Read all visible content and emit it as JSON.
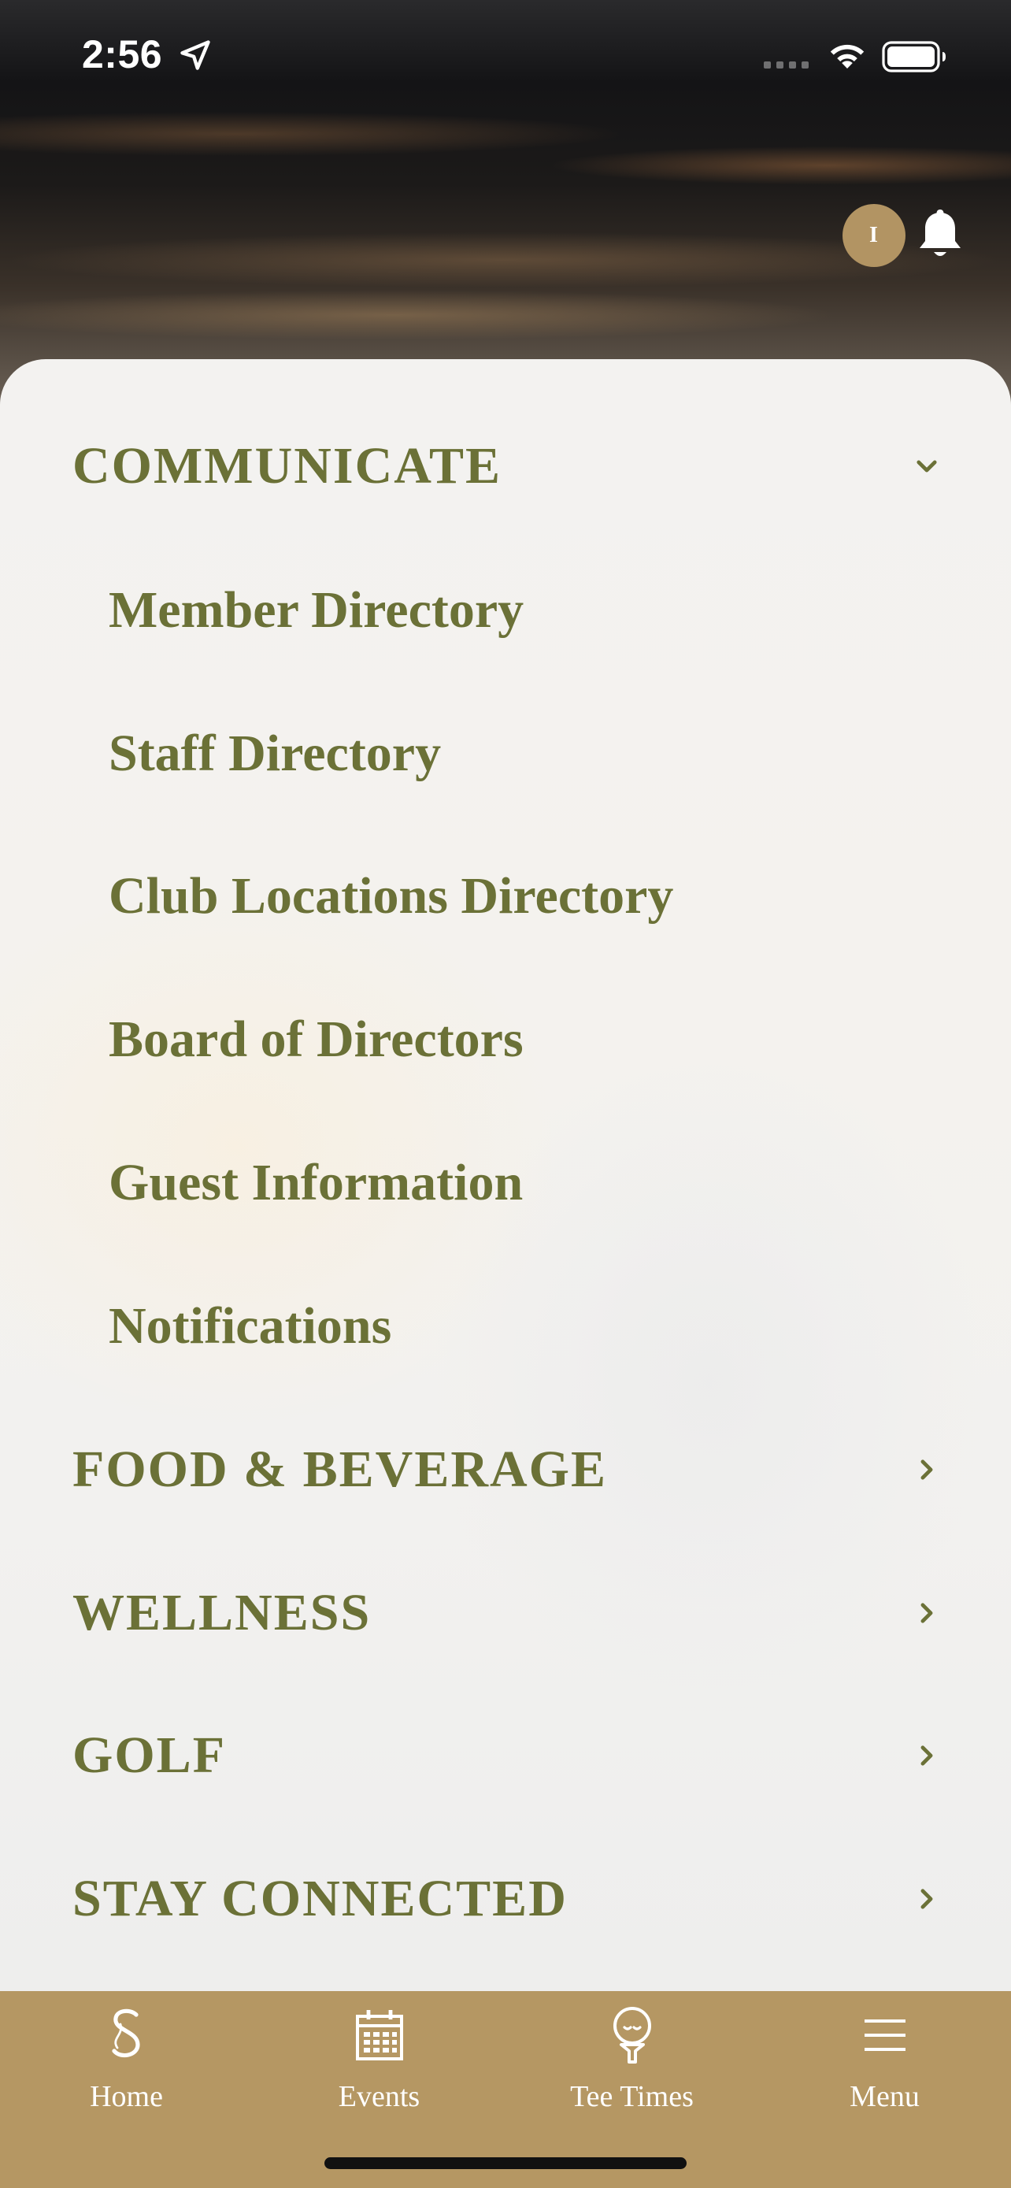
{
  "status_bar": {
    "time": "2:56"
  },
  "header": {
    "avatar_initial": "I"
  },
  "menu": {
    "sections": [
      {
        "label": "COMMUNICATE",
        "expanded": true,
        "items": [
          {
            "label": "Member Directory"
          },
          {
            "label": "Staff Directory"
          },
          {
            "label": "Club Locations Directory"
          },
          {
            "label": "Board of Directors"
          },
          {
            "label": "Guest Information"
          },
          {
            "label": "Notifications"
          }
        ]
      },
      {
        "label": "FOOD & BEVERAGE",
        "expanded": false
      },
      {
        "label": "WELLNESS",
        "expanded": false
      },
      {
        "label": "GOLF",
        "expanded": false
      },
      {
        "label": "STAY CONNECTED",
        "expanded": false
      }
    ]
  },
  "tab_bar": {
    "tabs": [
      {
        "label": "Home",
        "icon": "home-logo-icon"
      },
      {
        "label": "Events",
        "icon": "calendar-icon"
      },
      {
        "label": "Tee Times",
        "icon": "golf-ball-tee-icon"
      },
      {
        "label": "Menu",
        "icon": "hamburger-menu-icon"
      }
    ]
  },
  "colors": {
    "accent_gold": "#b59763",
    "avatar_gold": "#b29463",
    "menu_text_olive": "#6b7137"
  }
}
